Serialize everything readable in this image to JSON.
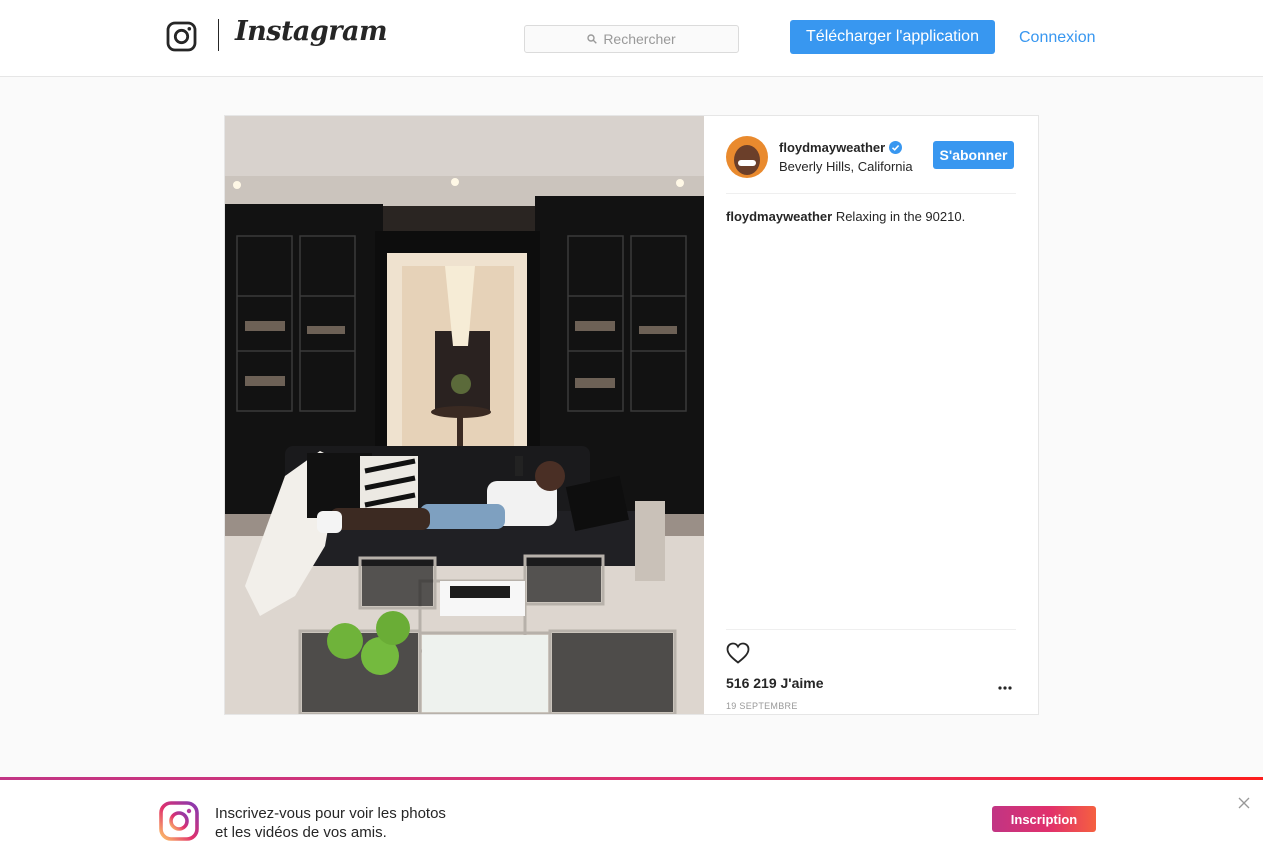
{
  "header": {
    "logo_text": "Instagram",
    "search_placeholder": "Rechercher",
    "download_label": "Télécharger l'application",
    "login_label": "Connexion",
    "logo_icon": "instagram-camera-icon"
  },
  "post": {
    "username": "floydmayweather",
    "verified": true,
    "location": "Beverly Hills, California",
    "follow_label": "S'abonner",
    "caption_user": "floydmayweather",
    "caption_text": " Relaxing in the 90210.",
    "likes": "516 219 J'aime",
    "date": "19 SEPTEMBRE",
    "icons": [
      "verified-badge-icon",
      "heart-icon",
      "more-options-icon"
    ]
  },
  "banner": {
    "line1": "Inscrivez-vous pour voir les photos",
    "line2": "et les vidéos de vos amis.",
    "signup_label": "Inscription",
    "icons": [
      "instagram-gradient-logo-icon",
      "close-icon"
    ]
  },
  "colors": {
    "accent": "#3897f0",
    "text": "#262626",
    "muted": "#999999",
    "background": "#fafafa"
  }
}
